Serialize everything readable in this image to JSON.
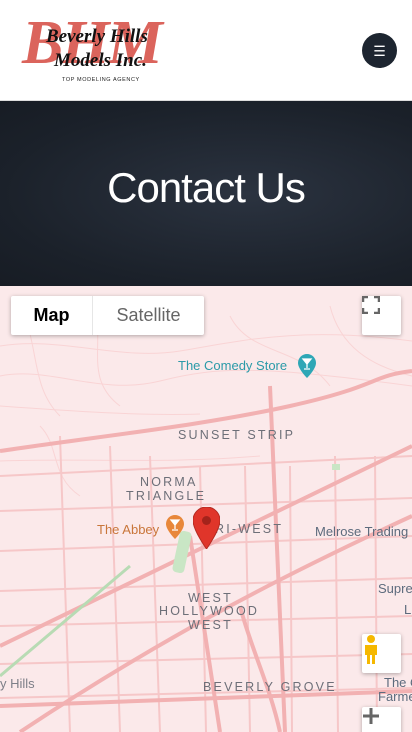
{
  "brand": {
    "logo_initials": "BHM",
    "logo_line1": "Beverly Hills",
    "logo_line2": "Models Inc.",
    "tagline": "TOP MODELING AGENCY"
  },
  "menu_icon": "hamburger-icon",
  "hero": {
    "title": "Contact Us"
  },
  "map": {
    "type_control": {
      "map": "Map",
      "satellite": "Satellite",
      "selected": "Map"
    },
    "places": {
      "comedy_store": "The Comedy Store",
      "abbey": "The Abbey",
      "melrose": "Melrose Trading",
      "supre": "Supre",
      "l_cut": "L",
      "hills": "y Hills",
      "the_o": "The O",
      "farmers": "Farmers M"
    },
    "districts": {
      "sunset_strip": "SUNSET STRIP",
      "norma1": "NORMA",
      "norma2": "TRIANGLE",
      "riwest": "RI-WEST",
      "wh1": "WEST",
      "wh2": "HOLLYWOOD",
      "wh3": "WEST",
      "beverly_grove": "BEVERLY GROVE"
    },
    "colors": {
      "road": "#f6c7c8",
      "major_road": "#f2b1b2",
      "park": "#c9e6c5",
      "poi_teal": "#2ea7b6",
      "poi_orange": "#e8873a",
      "marker": "#e0352a"
    }
  }
}
